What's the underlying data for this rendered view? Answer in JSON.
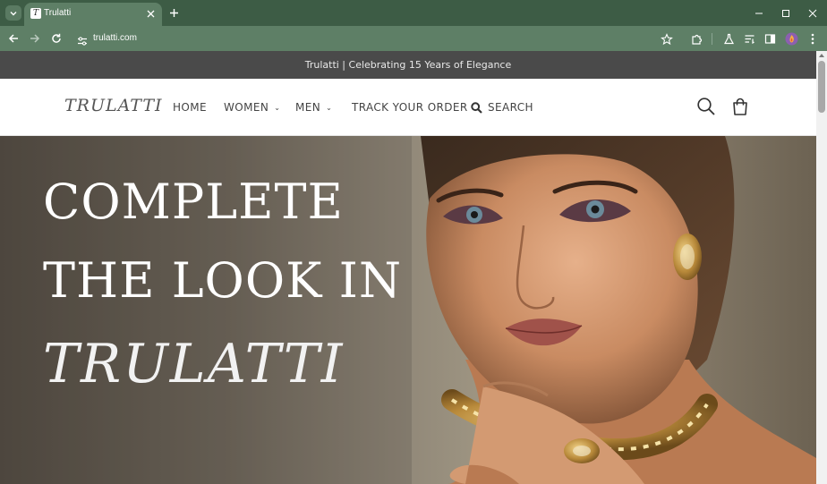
{
  "browser": {
    "tab_title": "Trulatti",
    "favicon_letter": "T",
    "url": "trulatti.com"
  },
  "announcement": "Trulatti | Celebrating 15 Years of Elegance",
  "header": {
    "logo": "TRULATTI",
    "nav": {
      "home": "HOME",
      "women": "WOMEN",
      "men": "MEN",
      "track": "TRACK YOUR ORDER",
      "search": "SEARCH"
    }
  },
  "hero": {
    "line1": "COMPLETE",
    "line2": "THE LOOK IN",
    "line3": "TRULATTI"
  },
  "icons": {
    "chrome": [
      "tab-search-icon",
      "close-icon",
      "plus-icon",
      "minimize-icon",
      "maximize-icon",
      "close-window-icon",
      "back-arrow-icon",
      "forward-arrow-icon",
      "reload-icon",
      "site-settings-icon",
      "star-icon",
      "extensions-icon",
      "flask-icon",
      "reading-list-icon",
      "side-panel-icon",
      "profile-avatar-icon",
      "more-menu-icon"
    ],
    "page": [
      "search-icon",
      "cart-icon"
    ]
  },
  "colors": {
    "chrome_frame": "#3d5c45",
    "chrome_toolbar": "#5e7f66",
    "announcement_bg": "#4a4a4a",
    "hero_text": "#ffffff"
  }
}
